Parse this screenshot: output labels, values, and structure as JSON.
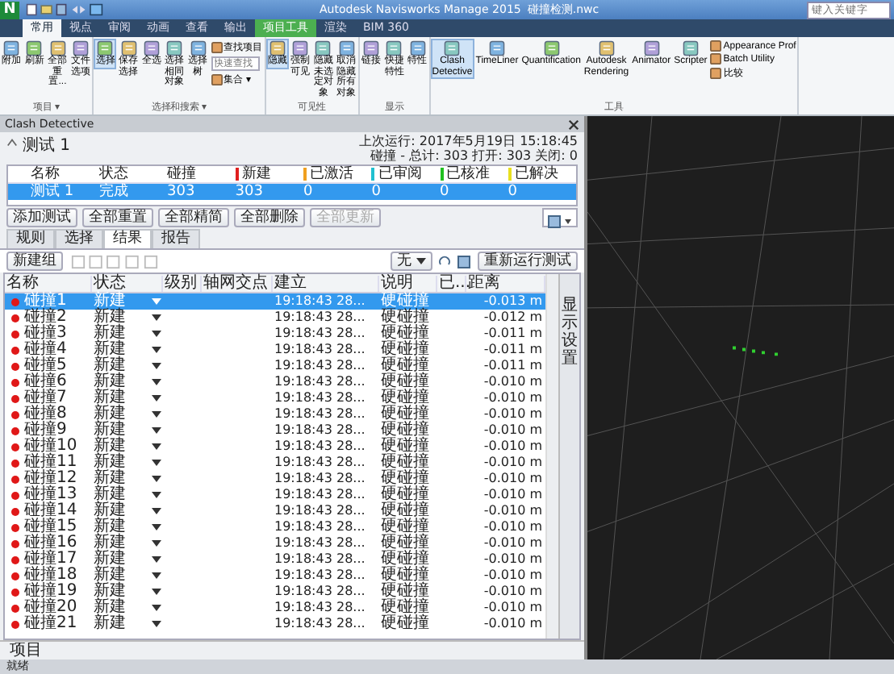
{
  "title_bar": {
    "logo": "N",
    "title": "Autodesk Navisworks Manage 2015",
    "file": "碰撞检测.nwc",
    "search_placeholder": "键入关键字"
  },
  "ribbon_tabs": [
    {
      "label": "常用",
      "selected": true,
      "kind": "normal"
    },
    {
      "label": "视点",
      "selected": false,
      "kind": "normal"
    },
    {
      "label": "审阅",
      "selected": false,
      "kind": "normal"
    },
    {
      "label": "动画",
      "selected": false,
      "kind": "normal"
    },
    {
      "label": "查看",
      "selected": false,
      "kind": "normal"
    },
    {
      "label": "输出",
      "selected": false,
      "kind": "normal"
    },
    {
      "label": "项目工具",
      "selected": false,
      "kind": "context"
    },
    {
      "label": "渲染",
      "selected": false,
      "kind": "normal"
    },
    {
      "label": "BIM 360",
      "selected": false,
      "kind": "normal"
    }
  ],
  "ribbon_groups": [
    {
      "label": "项目 ▾",
      "buttons": [
        {
          "kind": "large",
          "label": "附加",
          "selected": false
        },
        {
          "kind": "large",
          "label": "刷新",
          "selected": false
        },
        {
          "kind": "large",
          "label": "全部重置...",
          "selected": false
        },
        {
          "kind": "large",
          "label": "文件选项",
          "selected": false
        }
      ]
    },
    {
      "label": "选择和搜索 ▾",
      "buttons": [
        {
          "kind": "large",
          "label": "选择",
          "selected": true
        },
        {
          "kind": "large",
          "label": "保存选择",
          "selected": false
        },
        {
          "kind": "large",
          "label": "全选",
          "selected": false
        },
        {
          "kind": "large",
          "label": "选择相同对象",
          "selected": false
        },
        {
          "kind": "large",
          "label": "选择树",
          "selected": false
        },
        {
          "kind": "column",
          "items": [
            {
              "kind": "small",
              "label": "查找项目"
            },
            {
              "kind": "field",
              "placeholder": "快速查找"
            },
            {
              "kind": "small",
              "label": "集合 ▾"
            }
          ]
        }
      ]
    },
    {
      "label": "可见性",
      "buttons": [
        {
          "kind": "large",
          "label": "隐藏",
          "selected": true
        },
        {
          "kind": "large",
          "label": "强制可见",
          "selected": false
        },
        {
          "kind": "large",
          "label": "隐藏未选定对象",
          "selected": false
        },
        {
          "kind": "large",
          "label": "取消隐藏所有对象",
          "selected": false
        }
      ]
    },
    {
      "label": "显示",
      "buttons": [
        {
          "kind": "large",
          "label": "链接",
          "selected": false
        },
        {
          "kind": "large",
          "label": "快捷特性",
          "selected": false
        },
        {
          "kind": "large",
          "label": "特性",
          "selected": false
        }
      ]
    },
    {
      "label": "工具",
      "buttons": [
        {
          "kind": "large",
          "label": "Clash Detective",
          "selected": true
        },
        {
          "kind": "large",
          "label": "TimeLiner",
          "selected": false
        },
        {
          "kind": "large",
          "label": "Quantification",
          "selected": false
        },
        {
          "kind": "large",
          "label": "Autodesk Rendering",
          "selected": false
        },
        {
          "kind": "large",
          "label": "Animator",
          "selected": false
        },
        {
          "kind": "large",
          "label": "Scripter",
          "selected": false
        },
        {
          "kind": "column",
          "items": [
            {
              "kind": "small",
              "label": "Appearance Prof"
            },
            {
              "kind": "small",
              "label": "Batch Utility"
            },
            {
              "kind": "small",
              "label": "比较"
            }
          ]
        }
      ]
    }
  ],
  "panel": {
    "title": "Clash Detective",
    "test_name": "测试 1",
    "last_run": "上次运行: 2017年5月19日 15:18:45",
    "summary": "碰撞 - 总计: 303 打开: 303 关闭: 0"
  },
  "tests_table": {
    "columns": [
      {
        "label": "名称"
      },
      {
        "label": "状态"
      },
      {
        "label": "碰撞"
      },
      {
        "label": "新建",
        "color": "#e02020"
      },
      {
        "label": "已激活",
        "color": "#f0a020"
      },
      {
        "label": "已审阅",
        "color": "#20c0d0"
      },
      {
        "label": "已核准",
        "color": "#20c020"
      },
      {
        "label": "已解决",
        "color": "#e8e020"
      }
    ],
    "rows": [
      {
        "selected": true,
        "cells": [
          "测试 1",
          "完成",
          "303",
          "303",
          "0",
          "0",
          "0",
          "0"
        ]
      }
    ]
  },
  "test_buttons": [
    {
      "label": "添加测试",
      "disabled": false
    },
    {
      "label": "全部重置",
      "disabled": false
    },
    {
      "label": "全部精简",
      "disabled": false
    },
    {
      "label": "全部删除",
      "disabled": false
    },
    {
      "label": "全部更新",
      "disabled": true
    }
  ],
  "tabs": [
    {
      "label": "规则",
      "selected": false
    },
    {
      "label": "选择",
      "selected": false
    },
    {
      "label": "结果",
      "selected": true
    },
    {
      "label": "报告",
      "selected": false
    }
  ],
  "results_toolbar": {
    "new_group": "新建组",
    "filter": "无",
    "rerun": "重新运行测试"
  },
  "results": {
    "columns": [
      "名称",
      "状态",
      "级别",
      "轴网交点",
      "建立",
      "说明",
      "已...",
      "距离"
    ],
    "rows": [
      {
        "name": "碰撞1",
        "status": "新建",
        "created": "19:18:43 28...",
        "description": "硬碰撞",
        "distance": "-0.013 m",
        "selected": true
      },
      {
        "name": "碰撞2",
        "status": "新建",
        "created": "19:18:43 28...",
        "description": "硬碰撞",
        "distance": "-0.012 m",
        "selected": false
      },
      {
        "name": "碰撞3",
        "status": "新建",
        "created": "19:18:43 28...",
        "description": "硬碰撞",
        "distance": "-0.011 m",
        "selected": false
      },
      {
        "name": "碰撞4",
        "status": "新建",
        "created": "19:18:43 28...",
        "description": "硬碰撞",
        "distance": "-0.011 m",
        "selected": false
      },
      {
        "name": "碰撞5",
        "status": "新建",
        "created": "19:18:43 28...",
        "description": "硬碰撞",
        "distance": "-0.011 m",
        "selected": false
      },
      {
        "name": "碰撞6",
        "status": "新建",
        "created": "19:18:43 28...",
        "description": "硬碰撞",
        "distance": "-0.010 m",
        "selected": false
      },
      {
        "name": "碰撞7",
        "status": "新建",
        "created": "19:18:43 28...",
        "description": "硬碰撞",
        "distance": "-0.010 m",
        "selected": false
      },
      {
        "name": "碰撞8",
        "status": "新建",
        "created": "19:18:43 28...",
        "description": "硬碰撞",
        "distance": "-0.010 m",
        "selected": false
      },
      {
        "name": "碰撞9",
        "status": "新建",
        "created": "19:18:43 28...",
        "description": "硬碰撞",
        "distance": "-0.010 m",
        "selected": false
      },
      {
        "name": "碰撞10",
        "status": "新建",
        "created": "19:18:43 28...",
        "description": "硬碰撞",
        "distance": "-0.010 m",
        "selected": false
      },
      {
        "name": "碰撞11",
        "status": "新建",
        "created": "19:18:43 28...",
        "description": "硬碰撞",
        "distance": "-0.010 m",
        "selected": false
      },
      {
        "name": "碰撞12",
        "status": "新建",
        "created": "19:18:43 28...",
        "description": "硬碰撞",
        "distance": "-0.010 m",
        "selected": false
      },
      {
        "name": "碰撞13",
        "status": "新建",
        "created": "19:18:43 28...",
        "description": "硬碰撞",
        "distance": "-0.010 m",
        "selected": false
      },
      {
        "name": "碰撞14",
        "status": "新建",
        "created": "19:18:43 28...",
        "description": "硬碰撞",
        "distance": "-0.010 m",
        "selected": false
      },
      {
        "name": "碰撞15",
        "status": "新建",
        "created": "19:18:43 28...",
        "description": "硬碰撞",
        "distance": "-0.010 m",
        "selected": false
      },
      {
        "name": "碰撞16",
        "status": "新建",
        "created": "19:18:43 28...",
        "description": "硬碰撞",
        "distance": "-0.010 m",
        "selected": false
      },
      {
        "name": "碰撞17",
        "status": "新建",
        "created": "19:18:43 28...",
        "description": "硬碰撞",
        "distance": "-0.010 m",
        "selected": false
      },
      {
        "name": "碰撞18",
        "status": "新建",
        "created": "19:18:43 28...",
        "description": "硬碰撞",
        "distance": "-0.010 m",
        "selected": false
      },
      {
        "name": "碰撞19",
        "status": "新建",
        "created": "19:18:43 28...",
        "description": "硬碰撞",
        "distance": "-0.010 m",
        "selected": false
      },
      {
        "name": "碰撞20",
        "status": "新建",
        "created": "19:18:43 28...",
        "description": "硬碰撞",
        "distance": "-0.010 m",
        "selected": false
      },
      {
        "name": "碰撞21",
        "status": "新建",
        "created": "19:18:43 28...",
        "description": "硬碰撞",
        "distance": "-0.010 m",
        "selected": false
      }
    ]
  },
  "side_panel": {
    "label": "显示设置"
  },
  "items_panel": {
    "label": "项目"
  },
  "status_bar": {
    "text": "就绪"
  }
}
